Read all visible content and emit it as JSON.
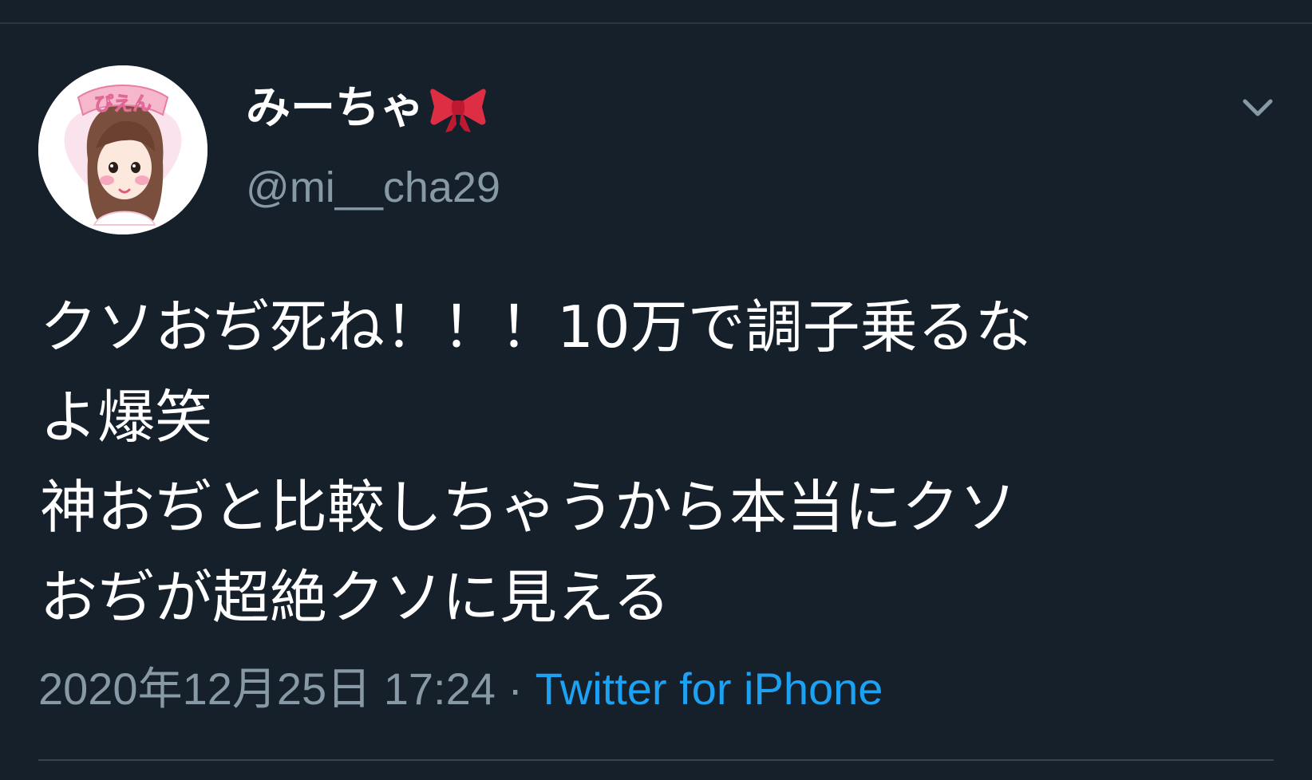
{
  "tweet": {
    "display_name": "みーちゃ",
    "name_emoji_icon": "ribbon-bow-icon",
    "handle": "@mi__cha29",
    "text_lines": [
      "クソおぢ死ね！！！10万で調子乗るな",
      "よ爆笑",
      "神おぢと比較しちゃうから本当にクソ",
      "おぢが超絶クソに見える"
    ],
    "date": "2020年12月25日",
    "time": "17:24",
    "separator": "·",
    "source": "Twitter for iPhone",
    "avatar_text": "ぴえん"
  },
  "icons": {
    "more": "chevron-down-icon",
    "avatar": "profile-avatar"
  },
  "colors": {
    "background": "#15202b",
    "primary_text": "#ffffff",
    "secondary_text": "#8899a6",
    "link": "#1da1f2",
    "bow": "#e0245e"
  }
}
